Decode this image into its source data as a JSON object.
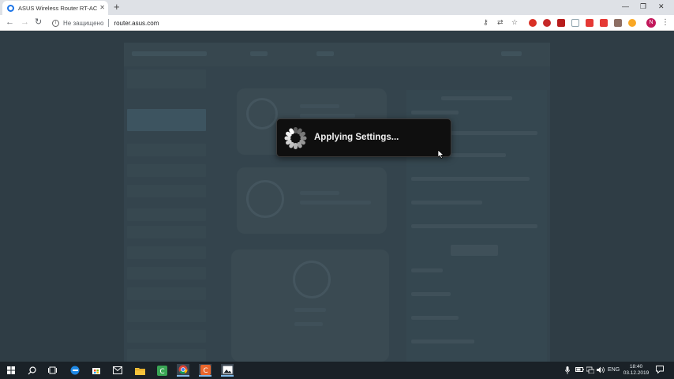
{
  "browser": {
    "tab": {
      "title": "ASUS Wireless Router RT-AC750..."
    },
    "new_tab": "+",
    "window_controls": {
      "minimize": "—",
      "maximize": "❐",
      "close": "✕"
    },
    "address_bar": {
      "security_label": "Не защищено",
      "url": "router.asus.com"
    }
  },
  "modal": {
    "message": "Applying Settings..."
  },
  "taskbar": {
    "language": "ENG",
    "time": "18:40",
    "date": "03.12.2019"
  },
  "colors": {
    "page_overlay": "#2f3d45",
    "modal_bg": "#0f0f0f",
    "modal_text": "#f2f2f2"
  }
}
